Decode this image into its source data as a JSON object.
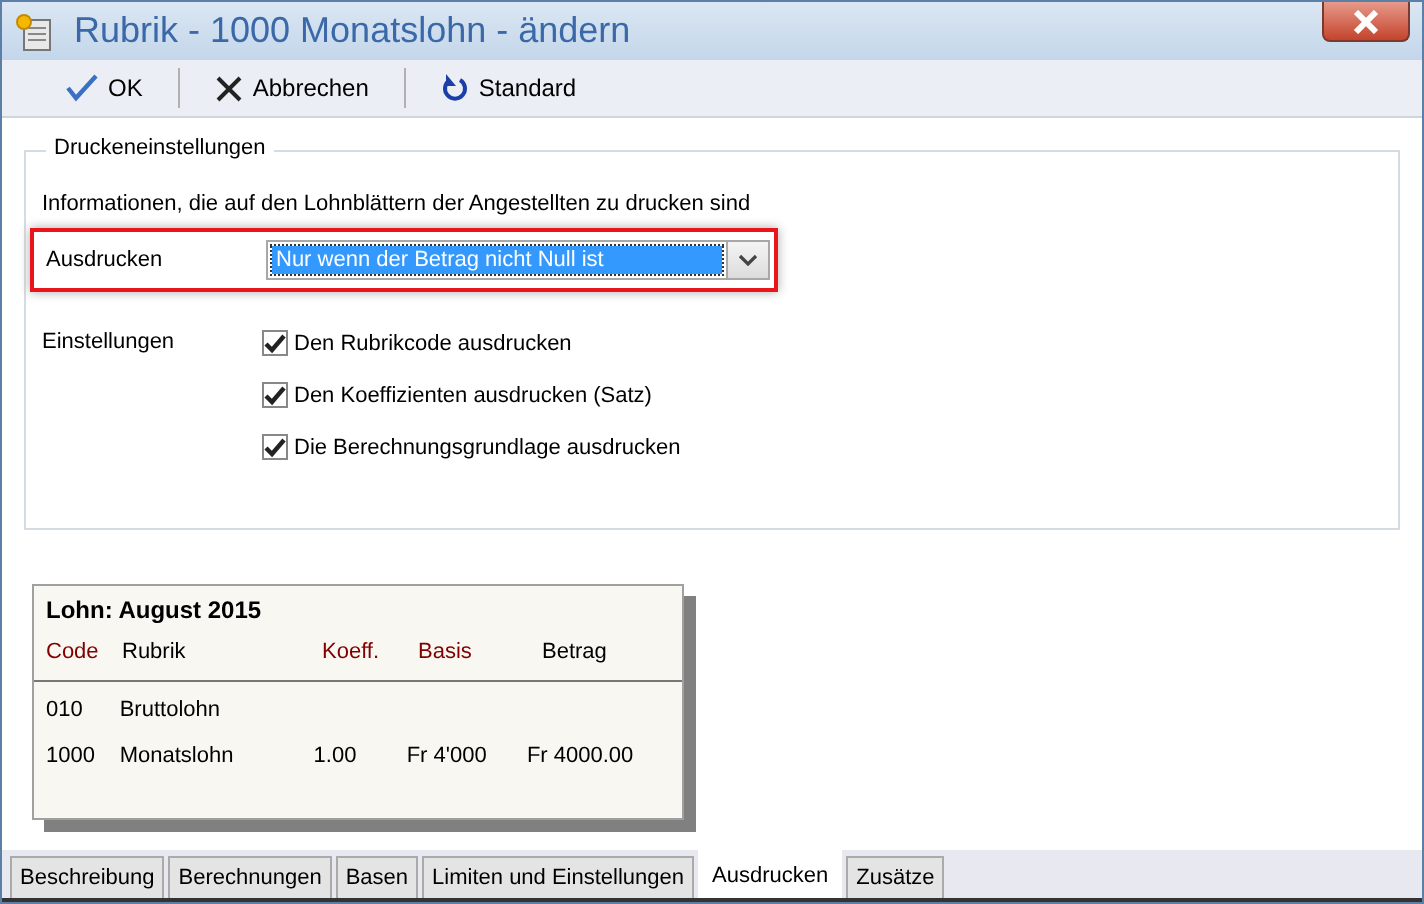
{
  "window": {
    "title": "Rubrik - 1000 Monatslohn - ändern"
  },
  "toolbar": [
    {
      "label": "OK",
      "kind": "ok"
    },
    {
      "label": "Abbrechen",
      "kind": "cancel"
    },
    {
      "label": "Standard",
      "kind": "reset"
    }
  ],
  "group": {
    "title": "Druckeneinstellungen",
    "info": "Informationen, die auf den Lohnblättern der Angestellten zu drucken sind",
    "print_label": "Ausdrucken",
    "print_value": "Nur wenn der Betrag nicht Null ist",
    "settings_label": "Einstellungen",
    "options": [
      {
        "label": "Den Rubrikcode ausdrucken",
        "checked": true
      },
      {
        "label": "Den Koeffizienten ausdrucken (Satz)",
        "checked": true
      },
      {
        "label": "Die Berechnungsgrundlage ausdrucken",
        "checked": true
      }
    ]
  },
  "preview": {
    "title": "Lohn: August 2015",
    "columns": [
      {
        "label": "Code",
        "color": "#800000"
      },
      {
        "label": "Rubrik",
        "color": "#000000"
      },
      {
        "label": "Koeff.",
        "color": "#800000"
      },
      {
        "label": "Basis",
        "color": "#800000"
      },
      {
        "label": "Betrag",
        "color": "#000000"
      }
    ],
    "rows": [
      [
        "010",
        "Bruttolohn",
        "",
        "",
        ""
      ],
      [
        "1000",
        "Monatslohn",
        "1.00",
        "Fr 4'000",
        "Fr 4000.00"
      ]
    ]
  },
  "tabs": [
    {
      "label": "Beschreibung",
      "selected": false
    },
    {
      "label": "Berechnungen",
      "selected": false
    },
    {
      "label": "Basen",
      "selected": false
    },
    {
      "label": "Limiten und Einstellungen",
      "selected": false
    },
    {
      "label": "Ausdrucken",
      "selected": true
    },
    {
      "label": "Zusätze",
      "selected": false
    }
  ]
}
